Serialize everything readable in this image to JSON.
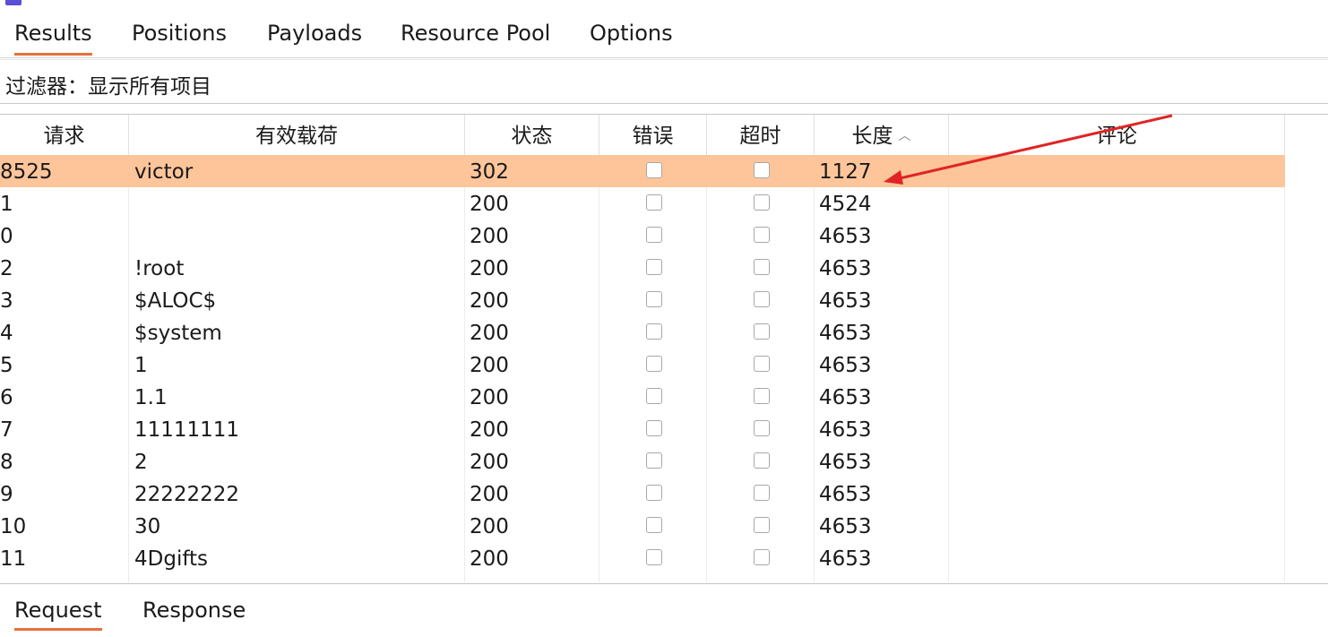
{
  "colors": {
    "accent": "#e8703a",
    "selected_row": "#fec59b",
    "annotation_arrow": "#e02424"
  },
  "tabs_top": [
    {
      "label": "Results",
      "active": true
    },
    {
      "label": "Positions",
      "active": false
    },
    {
      "label": "Payloads",
      "active": false
    },
    {
      "label": "Resource Pool",
      "active": false
    },
    {
      "label": "Options",
      "active": false
    }
  ],
  "filter": {
    "label": "过滤器：显示所有项目"
  },
  "table": {
    "headers": {
      "request": "请求",
      "payload": "有效载荷",
      "status": "状态",
      "error": "错误",
      "timeout": "超时",
      "length": "长度",
      "comment": "评论"
    },
    "sort_icon": "chevron-up-icon",
    "rows": [
      {
        "request": "8525",
        "payload": "victor",
        "status": "302",
        "error": false,
        "timeout": false,
        "length": "1127",
        "selected": true
      },
      {
        "request": "1",
        "payload": "",
        "status": "200",
        "error": false,
        "timeout": false,
        "length": "4524",
        "selected": false
      },
      {
        "request": "0",
        "payload": "",
        "status": "200",
        "error": false,
        "timeout": false,
        "length": "4653",
        "selected": false
      },
      {
        "request": "2",
        "payload": "!root",
        "status": "200",
        "error": false,
        "timeout": false,
        "length": "4653",
        "selected": false
      },
      {
        "request": "3",
        "payload": "$ALOC$",
        "status": "200",
        "error": false,
        "timeout": false,
        "length": "4653",
        "selected": false
      },
      {
        "request": "4",
        "payload": "$system",
        "status": "200",
        "error": false,
        "timeout": false,
        "length": "4653",
        "selected": false
      },
      {
        "request": "5",
        "payload": "1",
        "status": "200",
        "error": false,
        "timeout": false,
        "length": "4653",
        "selected": false
      },
      {
        "request": "6",
        "payload": "1.1",
        "status": "200",
        "error": false,
        "timeout": false,
        "length": "4653",
        "selected": false
      },
      {
        "request": "7",
        "payload": "11111111",
        "status": "200",
        "error": false,
        "timeout": false,
        "length": "4653",
        "selected": false
      },
      {
        "request": "8",
        "payload": "2",
        "status": "200",
        "error": false,
        "timeout": false,
        "length": "4653",
        "selected": false
      },
      {
        "request": "9",
        "payload": "22222222",
        "status": "200",
        "error": false,
        "timeout": false,
        "length": "4653",
        "selected": false
      },
      {
        "request": "10",
        "payload": "30",
        "status": "200",
        "error": false,
        "timeout": false,
        "length": "4653",
        "selected": false
      },
      {
        "request": "11",
        "payload": "4Dgifts",
        "status": "200",
        "error": false,
        "timeout": false,
        "length": "4653",
        "selected": false
      }
    ]
  },
  "tabs_bottom": [
    {
      "label": "Request",
      "active": true
    },
    {
      "label": "Response",
      "active": false
    }
  ]
}
